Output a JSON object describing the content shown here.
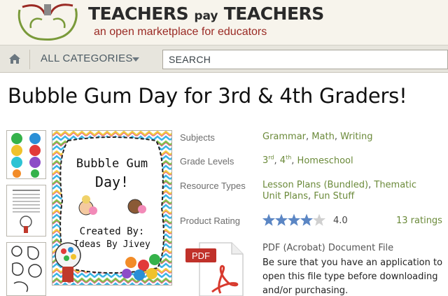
{
  "brand": {
    "title_main": "TEACHERS",
    "title_pay": "pay",
    "title_end": "TEACHERS",
    "tagline": "an open marketplace for educators"
  },
  "nav": {
    "categories_label": "ALL CATEGORIES",
    "search_placeholder": "SEARCH"
  },
  "product": {
    "title": "Bubble Gum Day for 3rd & 4th Graders!",
    "image_text": {
      "line1": "Bubble Gum",
      "line2": "Day!",
      "line3": "Created By:",
      "line4": "Ideas By Jivey"
    },
    "subjects_label": "Subjects",
    "subjects": [
      "Grammar",
      "Math",
      "Writing"
    ],
    "grade_levels_label": "Grade Levels",
    "grade_levels": [
      {
        "num": "3",
        "suffix": "rd"
      },
      {
        "num": "4",
        "suffix": "th"
      }
    ],
    "grade_extra": "Homeschool",
    "resource_types_label": "Resource Types",
    "resource_types_line1": [
      "Lesson Plans (Bundled)",
      "Thematic"
    ],
    "resource_types_line2": [
      "Unit Plans",
      "Fun Stuff"
    ],
    "rating_label": "Product Rating",
    "rating_value": "4.0",
    "rating_stars": 4,
    "rating_count": "13 ratings",
    "pdf_badge": "PDF",
    "file_type": "PDF (Acrobat) Document File",
    "file_note": "Be sure that you have an application to open this file type before downloading and/or purchasing."
  },
  "colors": {
    "link_green": "#6b8a3a",
    "tagline_red": "#9a2a24",
    "star_blue": "#5b86c4"
  }
}
